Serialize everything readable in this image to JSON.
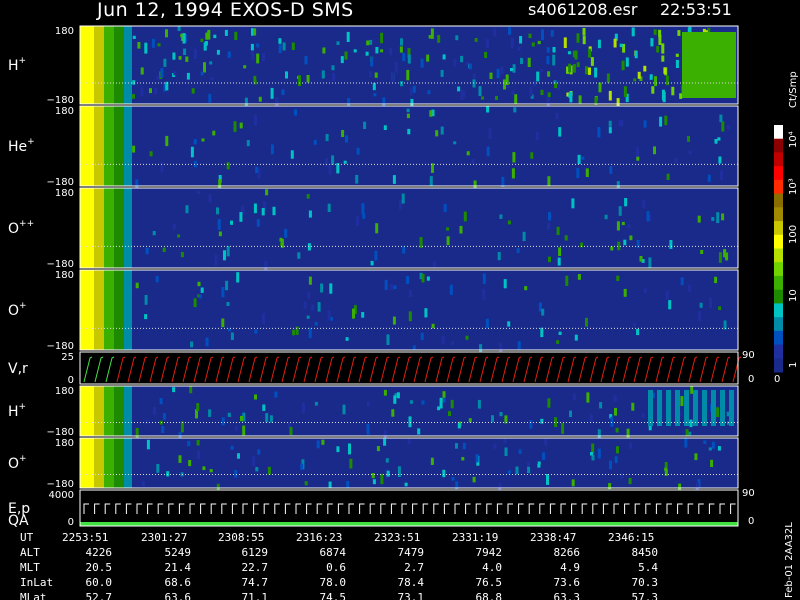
{
  "header": {
    "title": "Jun 12, 1994   EXOS-D SMS",
    "file": "s4061208.esr",
    "time": "22:53:51"
  },
  "panels": [
    {
      "id": "h",
      "base": "H",
      "sup": "+",
      "top": "180",
      "bottom": "−180",
      "kind": "spec"
    },
    {
      "id": "he",
      "base": "He",
      "sup": "+",
      "top": "180",
      "bottom": "−180",
      "kind": "spec"
    },
    {
      "id": "opp",
      "base": "O",
      "sup": "++",
      "top": "180",
      "bottom": "−180",
      "kind": "spec"
    },
    {
      "id": "o",
      "base": "O",
      "sup": "+",
      "top": "180",
      "bottom": "−180",
      "kind": "spec"
    },
    {
      "id": "vr",
      "base": "V,r",
      "sup": "",
      "top": "25",
      "bottom": "0",
      "right": "90",
      "right_bottom": "0",
      "kind": "line"
    },
    {
      "id": "h2",
      "base": "H",
      "sup": "+",
      "top": "180",
      "bottom": "−180",
      "kind": "spec"
    },
    {
      "id": "o2",
      "base": "O",
      "sup": "+",
      "top": "180",
      "bottom": "−180",
      "kind": "spec"
    },
    {
      "id": "ep",
      "base": "E,p",
      "base2": "QA",
      "sup": "",
      "top": "4000",
      "bottom": "0",
      "right": "90",
      "right_bottom": "0",
      "kind": "line"
    }
  ],
  "colorbar": {
    "unit": "Ct/Smp",
    "labels": [
      "10⁴",
      "10³",
      "100",
      "10",
      "1"
    ],
    "right_zero": "0",
    "colors": [
      "#ffffff",
      "#8b0000",
      "#c00000",
      "#ff0000",
      "#ff2a00",
      "#8b6e00",
      "#a08a00",
      "#c8c800",
      "#ffff00",
      "#b6e000",
      "#70d400",
      "#3cb000",
      "#1d8a00",
      "#00c4c4",
      "#008ca8",
      "#0050c0",
      "#1f2fa0",
      "#1a2a8a"
    ]
  },
  "table": {
    "rows": [
      {
        "label": "UT",
        "values": [
          "2253:51",
          "2301:27",
          "2308:55",
          "2316:23",
          "2323:51",
          "2331:19",
          "2338:47",
          "2346:15"
        ]
      },
      {
        "label": "ALT",
        "values": [
          "4226",
          "5249",
          "6129",
          "6874",
          "7479",
          "7942",
          "8266",
          "8450"
        ]
      },
      {
        "label": "MLT",
        "values": [
          "20.5",
          "21.4",
          "22.7",
          "0.6",
          "2.7",
          "4.0",
          "4.9",
          "5.4"
        ]
      },
      {
        "label": "InLat",
        "values": [
          "60.0",
          "68.6",
          "74.7",
          "78.0",
          "78.4",
          "76.5",
          "73.6",
          "70.3"
        ]
      },
      {
        "label": "MLat",
        "values": [
          "52.7",
          "63.6",
          "71.1",
          "74.5",
          "73.1",
          "68.8",
          "63.3",
          "57.3"
        ]
      }
    ]
  },
  "footer": {
    "vertical_text": "Feb-01  2AA32L"
  },
  "chart_data": {
    "type": "heatmap",
    "title": "Jun 12, 1994   EXOS-D SMS",
    "x_tick_labels": [
      "2253:51",
      "2301:27",
      "2308:55",
      "2316:23",
      "2323:51",
      "2331:19",
      "2338:47",
      "2346:15"
    ],
    "panels": [
      {
        "name": "H+",
        "ylim": [
          -180,
          180
        ]
      },
      {
        "name": "He+",
        "ylim": [
          -180,
          180
        ]
      },
      {
        "name": "O++",
        "ylim": [
          -180,
          180
        ]
      },
      {
        "name": "O+",
        "ylim": [
          -180,
          180
        ]
      },
      {
        "name": "V,r",
        "ylim": [
          0,
          25
        ],
        "right_ylim": [
          0,
          90
        ]
      },
      {
        "name": "H+",
        "ylim": [
          -180,
          180
        ]
      },
      {
        "name": "O+",
        "ylim": [
          -180,
          180
        ]
      },
      {
        "name": "E,p",
        "ylim": [
          0,
          4000
        ],
        "right_ylim": [
          0,
          90
        ]
      }
    ],
    "colorbar": {
      "label": "Ct/Smp",
      "ticks": [
        "1",
        "10",
        "100",
        "10³",
        "10⁴"
      ]
    }
  }
}
